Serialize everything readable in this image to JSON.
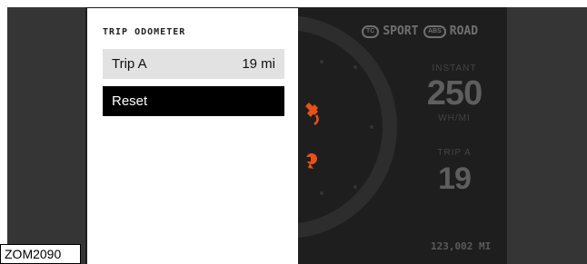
{
  "panel": {
    "title": "TRIP ODOMETER",
    "trip_label": "Trip A",
    "trip_value": "19 mi",
    "reset_label": "Reset"
  },
  "cluster": {
    "mode_sport_badge": "TC",
    "mode_sport": "SPORT",
    "mode_road_badge": "ABS",
    "mode_road": "ROAD",
    "instant_label": "INSTANT",
    "instant_value": "250",
    "instant_unit": "WH/MI",
    "trip_label": "TRIP A",
    "trip_value": "19",
    "odometer": "123,002 MI"
  },
  "figure_id": "ZOM2090",
  "colors": {
    "accent": "#e8501a",
    "panel_selected": "#000000",
    "panel_row": "#e2e2e2",
    "screen": "#1e1e1e"
  },
  "icons": {
    "warning_1": "motor-warning-icon",
    "warning_2": "brake-warning-icon"
  }
}
